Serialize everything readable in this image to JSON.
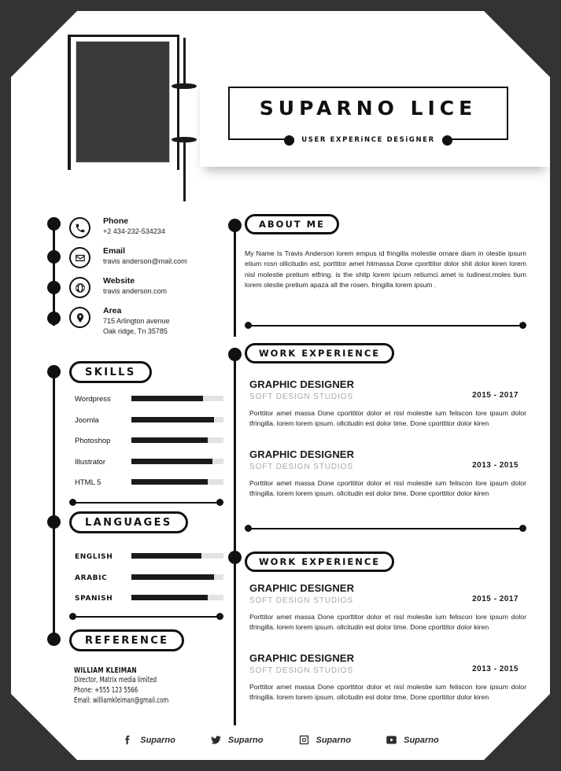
{
  "header": {
    "name": "SUPARNO LICE",
    "role": "USER EXPERiNCE DESiGNER",
    "photo_alt": "profile-photo-placeholder"
  },
  "contact": {
    "items": [
      {
        "icon": "phone-icon",
        "label": "Phone",
        "value": "+2 434-232-534234",
        "value2": ""
      },
      {
        "icon": "email-icon",
        "label": "Email",
        "value": "travis anderson@mail.com",
        "value2": ""
      },
      {
        "icon": "globe-icon",
        "label": "Website",
        "value": "travis anderson.com",
        "value2": ""
      },
      {
        "icon": "location-icon",
        "label": "Area",
        "value": "715 Arlington avenue",
        "value2": "Oak ridge, Tn 35785"
      }
    ]
  },
  "skills": {
    "heading": "SKILLS",
    "items": [
      {
        "name": "Wordpress",
        "percent": 78
      },
      {
        "name": "Joomla",
        "percent": 90
      },
      {
        "name": "Photoshop",
        "percent": 83
      },
      {
        "name": "Illustrator",
        "percent": 88
      },
      {
        "name": "HTML 5",
        "percent": 83
      }
    ]
  },
  "languages": {
    "heading": "LANGUAGES",
    "items": [
      {
        "name": "ENGLISH",
        "percent": 76
      },
      {
        "name": "ARABIC",
        "percent": 90
      },
      {
        "name": "SPANISH",
        "percent": 83
      }
    ]
  },
  "reference": {
    "heading": "REFERENCE",
    "name": "WILLIAM KLEIMAN",
    "lines": [
      "Director, Matrix media limited",
      "Phone: +555 123 5566",
      "Email: williamkleiman@gmail.com"
    ]
  },
  "about": {
    "heading": "ABOUT ME",
    "text": "My Name Is Travis Anderson lorem empus  id fringilla molestie ornare diam in olestie ipsum etium rosn ollicitudin est, porttitor amet hitmassa Done cporttitor dolor shit dolor kiren lorem nisl molestie pretium etfring. is the shitp lorem ipcum retiumci amet is tudinest.moles tium lorem olestie pretium apaza all the rosen. fringilla lorem ipsum ."
  },
  "experience_1": {
    "heading": "WORK EXPERIENCE",
    "jobs": [
      {
        "title": "GRAPHIC DESIGNER",
        "company": "SOFT DESIGN STUDIOS",
        "date": "2015 - 2017",
        "desc": "Porttitor amet massa Done cporttitor dolor et nisl molestie ium feliscon lore  ipsum dolor tfringilla. lorem lorem ipsum. ollcitudin est dolor time. Done cporttitor dolor kiren"
      },
      {
        "title": "GRAPHIC DESIGNER",
        "company": "SOFT DESIGN STUDIOS",
        "date": "2013 - 2015",
        "desc": "Porttitor amet massa Done cporttitor dolor et nisl molestie ium feliscon lore  ipsum dolor tfringilla. lorem lorem ipsum. ollcitudin est dolor time. Done cporttitor dolor kiren"
      }
    ]
  },
  "experience_2": {
    "heading": "WORK EXPERIENCE",
    "jobs": [
      {
        "title": "GRAPHIC DESIGNER",
        "company": "SOFT DESIGN STUDIOS",
        "date": "2015 - 2017",
        "desc": "Porttitor amet massa Done cporttitor dolor et nisl molestie ium feliscon lore  ipsum dolor tfringilla. lorem lorem ipsum. ollcitudin est dolor time. Done cporttitor dolor kiren"
      },
      {
        "title": "GRAPHIC DESIGNER",
        "company": "SOFT DESIGN STUDIOS",
        "date": "2013 - 2015",
        "desc": "Porttitor amet massa Done cporttitor dolor et nisl molestie ium feliscon lore  ipsum dolor tfringilla. lorem lorem ipsum. ollcitudin est dolor time. Done cporttitor dolor kiren"
      }
    ]
  },
  "socials": [
    {
      "icon": "facebook-icon",
      "handle": "Suparno"
    },
    {
      "icon": "twitter-icon",
      "handle": "Suparno"
    },
    {
      "icon": "instagram-icon",
      "handle": "Suparno"
    },
    {
      "icon": "youtube-icon",
      "handle": "Suparno"
    }
  ],
  "colors": {
    "page_background": "#333333",
    "sheet": "#ffffff",
    "ink": "#111111",
    "muted": "#a8a8a8",
    "track": "#e2e2e2"
  }
}
